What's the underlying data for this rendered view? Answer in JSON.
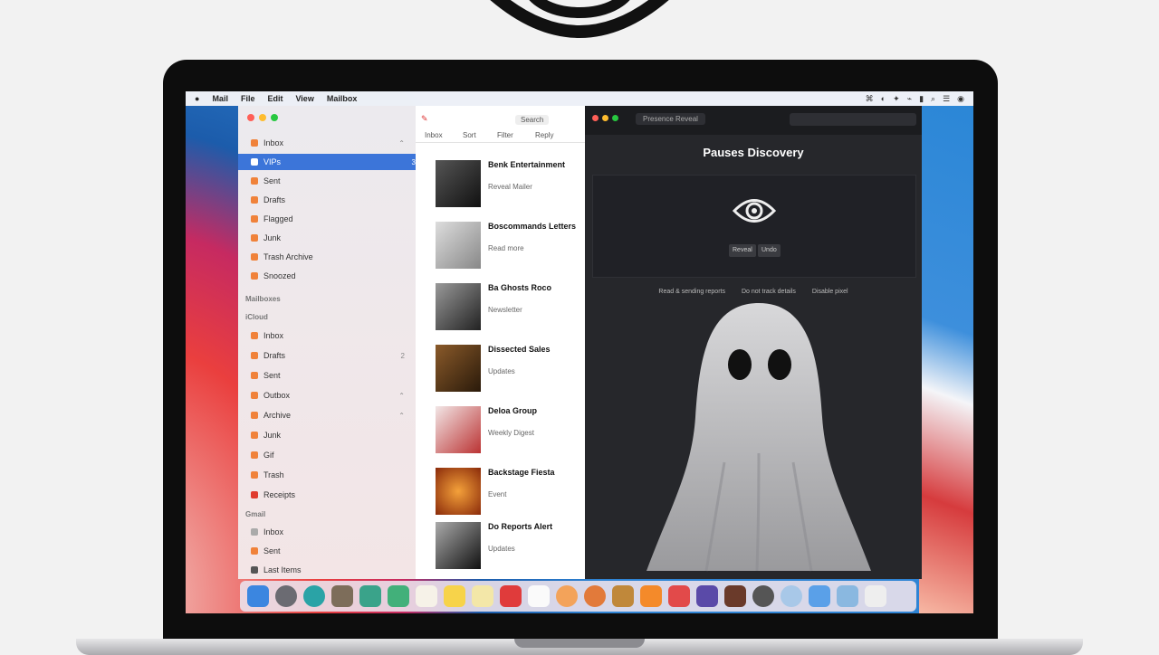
{
  "menubar": {
    "apple": "",
    "items": [
      "Mail",
      "File",
      "Edit",
      "View",
      "Mailbox"
    ],
    "right": [
      "⌘",
      "◐",
      "✦",
      "⌁",
      "▮",
      "⌕",
      "☰",
      "◉"
    ]
  },
  "mail": {
    "sidebar": {
      "top": {
        "label": "Inbox",
        "badge": "⌃"
      },
      "selected": {
        "label": "VIPs",
        "badge": "3"
      },
      "items": [
        {
          "label": "Sent"
        },
        {
          "label": "Drafts"
        },
        {
          "label": "Flagged"
        },
        {
          "label": "Junk"
        },
        {
          "label": "Trash Archive"
        },
        {
          "label": "Snoozed"
        }
      ],
      "section_label": "Mailboxes",
      "section_header": "iCloud",
      "items2": [
        {
          "label": "Inbox",
          "badge": ""
        },
        {
          "label": "Drafts",
          "badge": "2"
        },
        {
          "label": "Sent",
          "badge": ""
        },
        {
          "label": "Outbox",
          "badge": "⌃"
        },
        {
          "label": "Archive",
          "badge": "⌃"
        },
        {
          "label": "Junk",
          "badge": ""
        },
        {
          "label": "Gif",
          "badge": ""
        },
        {
          "label": "Trash",
          "badge": ""
        },
        {
          "label": "Receipts",
          "badge": ""
        }
      ],
      "section3": "Gmail",
      "items3": [
        {
          "label": "Inbox"
        },
        {
          "label": "Sent"
        },
        {
          "label": "Last Items"
        }
      ]
    },
    "list": {
      "search": "Search",
      "toolbar": [
        "Inbox",
        "Sort",
        "Filter",
        "Reply"
      ],
      "messages": [
        {
          "title": "Benk Entertainment",
          "sub": "Reveal Mailer"
        },
        {
          "title": "Boscommands Letters",
          "sub": "Read more"
        },
        {
          "title": "Ba Ghosts Roco",
          "sub": "Newsletter"
        },
        {
          "title": "Dissected Sales",
          "sub": "Updates"
        },
        {
          "title": "Deloa Group",
          "sub": "Weekly Digest"
        },
        {
          "title": "Backstage Fiesta",
          "sub": "Event"
        },
        {
          "title": "Do Reports Alert",
          "sub": "Updates"
        }
      ]
    }
  },
  "dark": {
    "bar_text": "Presence Reveal",
    "title": "Pauses Discovery",
    "buttons": [
      "Reveal",
      "Undo"
    ],
    "captions": [
      "Read & sending reports",
      "Do not track details",
      "Disable pixel"
    ]
  },
  "dock": {
    "count": 23
  },
  "colors": {
    "accent": "#3c75d9",
    "dark_bg": "#26272b",
    "ghost": "#cfcfd1"
  }
}
